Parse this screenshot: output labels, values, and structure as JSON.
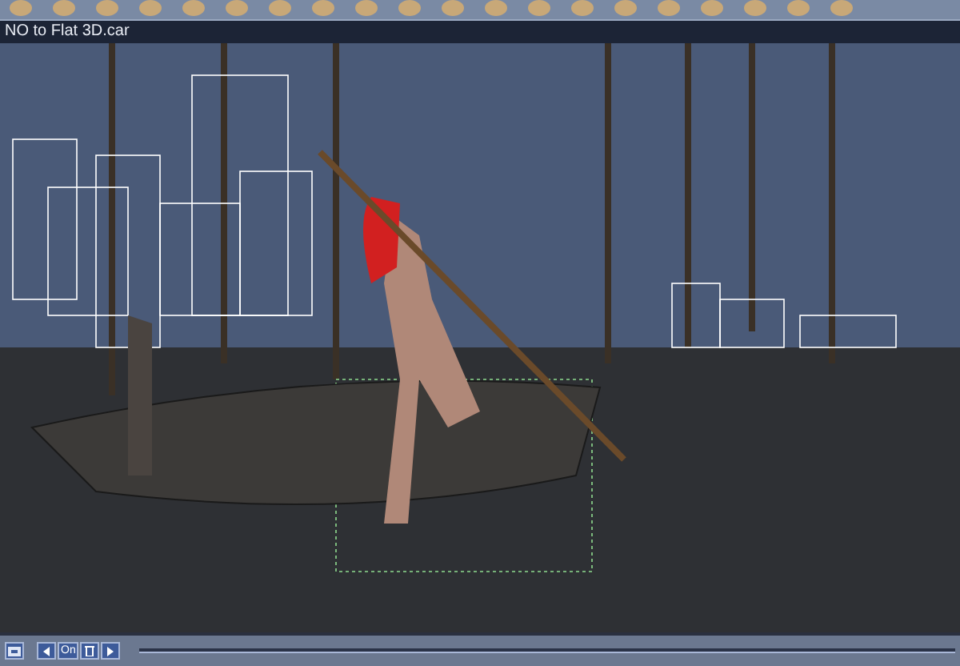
{
  "document": {
    "title": "NO to Flat 3D.car"
  },
  "timeline": {
    "toggle_label": "On"
  }
}
